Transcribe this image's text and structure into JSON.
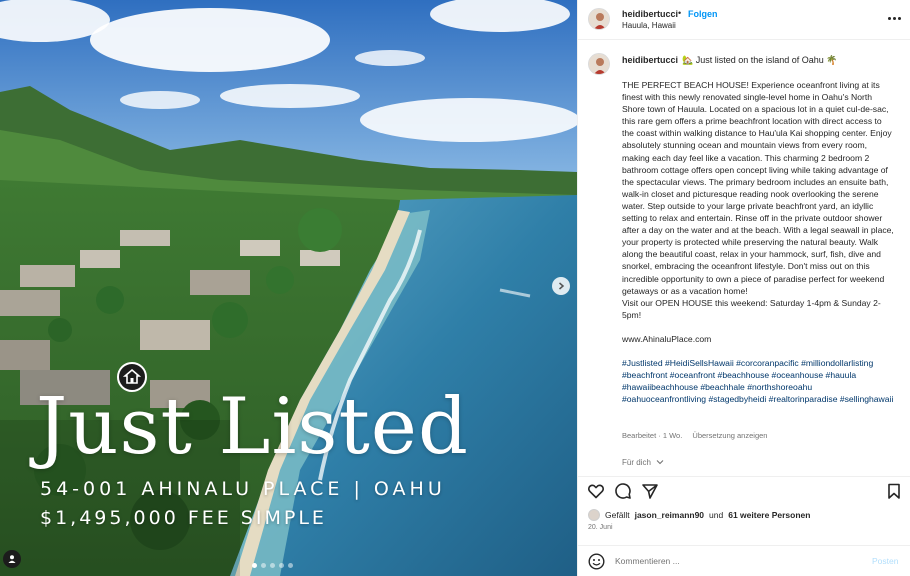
{
  "photo": {
    "headline": "Just Listed",
    "address": "54-001 AHINALU PLACE  |  OAHU",
    "price": "$1,495,000  FEE SIMPLE",
    "home_icon": "home-icon",
    "next_icon": "chevron-right-icon",
    "carousel_count": 5,
    "carousel_active": 0
  },
  "post_header": {
    "username": "heidibertucci",
    "separator": "•",
    "follow_label": "Folgen",
    "location": "Hauula, Hawaii",
    "more_icon": "more-horizontal-icon"
  },
  "caption": {
    "username": "heidibertucci",
    "intro": "🏡 Just listed on the island of Oahu 🌴",
    "body": "THE PERFECT BEACH HOUSE! Experience oceanfront living at its finest with this newly renovated single-level home in Oahu's North Shore town of Hauula. Located on a spacious lot in a quiet cul-de-sac, this rare gem offers a prime beachfront location with direct access to the coast within walking distance to Hau'ula Kai shopping center. Enjoy absolutely stunning ocean and mountain views from every room, making each day feel like a vacation. This charming 2 bedroom 2 bathroom cottage offers open concept living while taking advantage of the spectacular views. The primary bedroom includes an ensuite bath, walk-in closet and picturesque reading nook overlooking the serene water. Step outside to your large private beachfront yard, an idyllic setting to relax and entertain. Rinse off in the private outdoor shower after a day on the water and at the beach. With a legal seawall in place, your property is protected while preserving the natural beauty. Walk along the beautiful coast, relax in your hammock, surf, fish, dive and snorkel, embracing the oceanfront lifestyle. Don't miss out on this incredible opportunity to own a piece of paradise perfect for weekend getaways or as a vacation home!",
    "open_house": "Visit our OPEN HOUSE this weekend: Saturday 1-4pm & Sunday 2-5pm!",
    "url": "www.AhinaluPlace.com",
    "hashtags": "#Justlisted #HeidiSellsHawaii #corcoranpacific #milliondollarlisting #beachfront #oceanfront #beachhouse #oceanhouse #hauula #hawaiibeachhouse #beachhale #northshoreoahu #oahuoceanfrontliving #stagedbyheidi #realtorinparadise #sellinghawaii",
    "edited_label": "Bearbeitet · 1 Wo.",
    "translation_label": "Übersetzung anzeigen",
    "for_you_label": "Für dich",
    "for_you_icon": "chevron-down-icon"
  },
  "actions": {
    "like_icon": "heart-icon",
    "comment_icon": "comment-icon",
    "share_icon": "send-icon",
    "save_icon": "bookmark-icon"
  },
  "likes": {
    "prefix": "Gefällt",
    "user": "jason_reimann90",
    "middle": "und",
    "others": "61 weitere Personen"
  },
  "date": "20. Juni",
  "comment_bar": {
    "emoji_icon": "emoji-icon",
    "placeholder": "Kommentieren ...",
    "post_label": "Posten"
  }
}
